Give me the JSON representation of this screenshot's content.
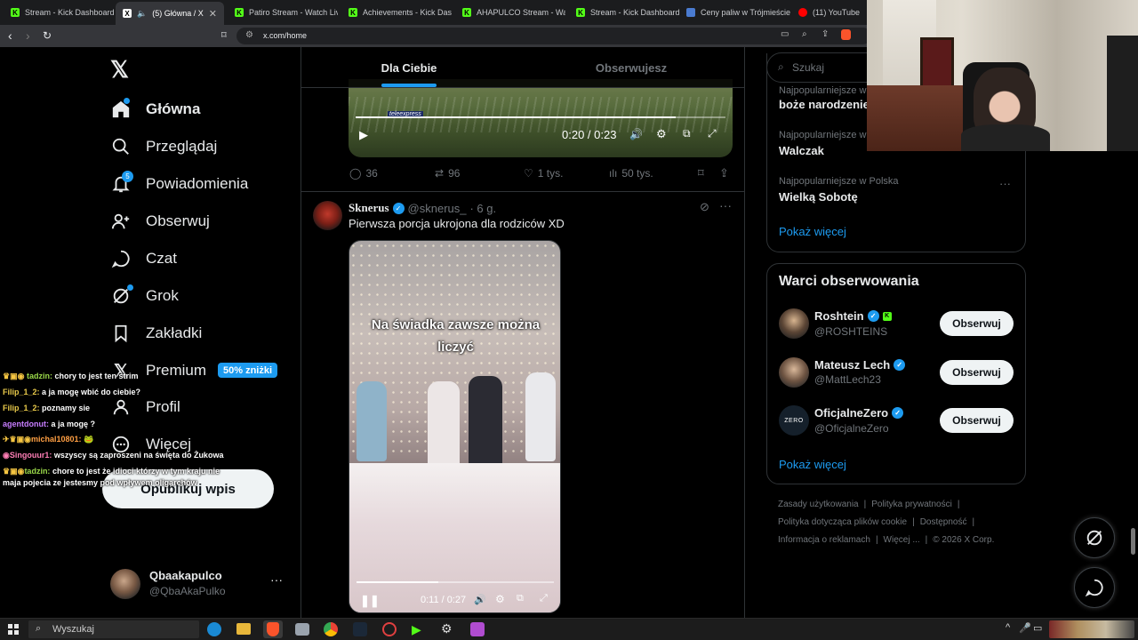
{
  "browser": {
    "tabs": [
      {
        "title": "Stream - Kick Dashboard",
        "icon": "kick"
      },
      {
        "title": "(5) Główna / X",
        "icon": "x"
      },
      {
        "title": "Patiro Stream - Watch Live",
        "icon": "kick"
      },
      {
        "title": "Achievements - Kick Dashb",
        "icon": "kick"
      },
      {
        "title": "AHAPULCO Stream - Watch",
        "icon": "kick"
      },
      {
        "title": "Stream - Kick Dashboard",
        "icon": "kick"
      },
      {
        "title": "Ceny paliw w Trójmieście",
        "icon": "gas"
      },
      {
        "title": "(11) YouTube",
        "icon": "youtube"
      }
    ],
    "url": "x.com/home"
  },
  "sidebar": {
    "nav": [
      {
        "label": "Główna",
        "icon": "home-icon"
      },
      {
        "label": "Przeglądaj",
        "icon": "search-icon"
      },
      {
        "label": "Powiadomienia",
        "icon": "bell-icon",
        "badge": "5"
      },
      {
        "label": "Obserwuj",
        "icon": "add-person-icon"
      },
      {
        "label": "Czat",
        "icon": "chat-icon"
      },
      {
        "label": "Grok",
        "icon": "grok-icon"
      },
      {
        "label": "Zakładki",
        "icon": "bookmark-icon"
      },
      {
        "label": "Premium",
        "icon": "x-icon",
        "badge": "50% zniżki"
      },
      {
        "label": "Profil",
        "icon": "person-icon"
      },
      {
        "label": "Więcej",
        "icon": "more-icon"
      }
    ],
    "post_button": "Opublikuj wpis",
    "account": {
      "name": "Qbaakapulco",
      "handle": "@QbaAkaPulko"
    }
  },
  "feed": {
    "tabs": [
      "Dla Ciebie",
      "Obserwujesz"
    ],
    "prev_video": {
      "time": "0:20 / 0:23",
      "watermark": "teleexpress"
    },
    "prev_stats": {
      "replies": "36",
      "reposts": "96",
      "likes": "1 tys.",
      "views": "50 tys."
    },
    "post": {
      "name": "Sknerus",
      "handle": "@sknerus_",
      "time": "· 6 g.",
      "text": "Pierwsza porcja ukrojona dla rodziców XD",
      "video_caption": "Na świadka zawsze można liczyć",
      "video_time": "0:11 / 0:27"
    }
  },
  "right": {
    "search_placeholder": "Szukaj",
    "trends": [
      {
        "context": "Najpopularniejsze w",
        "name": "boże narodzenie"
      },
      {
        "context": "Najpopularniejsze w",
        "name": "Walczak"
      },
      {
        "context": "Najpopularniejsze w Polska",
        "name": "Wielką Sobotę"
      }
    ],
    "show_more": "Pokaż więcej",
    "who_title": "Warci obserwowania",
    "who": [
      {
        "name": "Roshtein",
        "handle": "@ROSHTEINS"
      },
      {
        "name": "Mateusz Lech",
        "handle": "@MattLech23"
      },
      {
        "name": "OficjalneZero",
        "handle": "@OficjalneZero",
        "avatar_text": "ZERO"
      }
    ],
    "follow_label": "Obserwuj",
    "footer": [
      "Zasady użytkowania",
      "Polityka prywatności",
      "Polityka dotycząca plików cookie",
      "Dostępność",
      "Informacja o reklamach",
      "Więcej ...",
      "© 2026 X Corp."
    ]
  },
  "chat": [
    {
      "user": "tadzin:",
      "msg": "chory to jest ten strim",
      "color": "#9bd94a"
    },
    {
      "user": "Filip_1_2:",
      "msg": "a ja mogę wbić do ciebie?",
      "color": "#e8c94a"
    },
    {
      "user": "Filip_1_2:",
      "msg": "poznamy sie",
      "color": "#e8c94a"
    },
    {
      "user": "agentdonut:",
      "msg": "a ja mogę ?",
      "color": "#c77dff"
    },
    {
      "user": "michal10801:",
      "msg": "",
      "color": "#ff9f43"
    },
    {
      "user": "Singouur1:",
      "msg": "wszyscy są zaproszeni na święta do Żukowa",
      "color": "#ff7eb6"
    },
    {
      "user": "tadzin:",
      "msg": "chore to jest że idioci którzy w tym kraju nie",
      "color": "#9bd94a"
    },
    {
      "user": "",
      "msg": "maja pojecia ze jestesmy pod wpływem oligarchów",
      "color": "#ffffff"
    }
  ],
  "taskbar": {
    "search": "Wyszukaj"
  },
  "colors": {
    "accent": "#1d9bf0",
    "kick": "#53fc18",
    "bg": "#000000"
  }
}
